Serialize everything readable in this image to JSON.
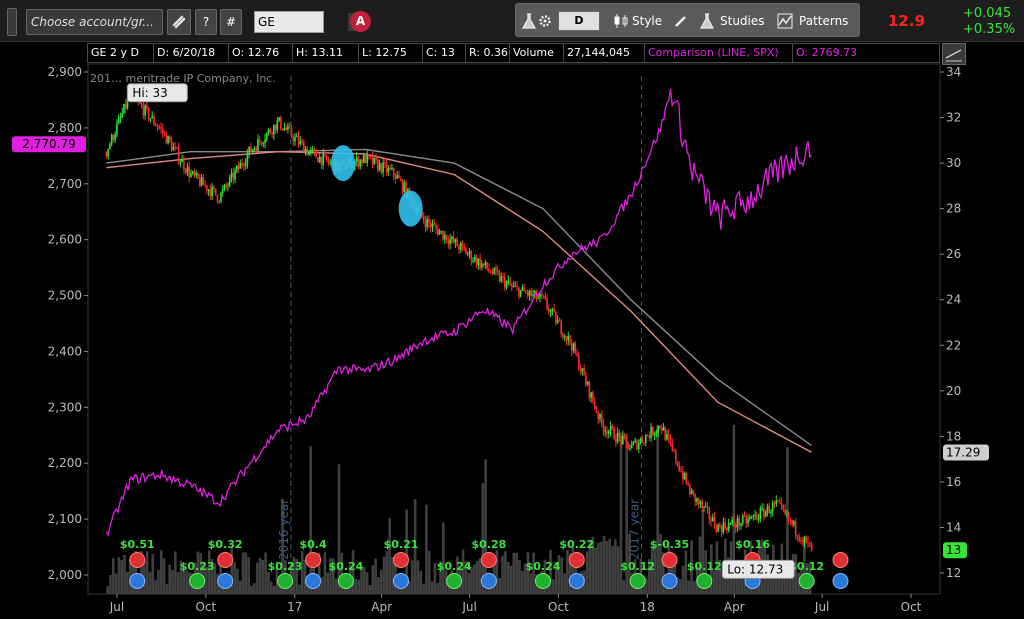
{
  "toolbar": {
    "account": "Choose account/gr...",
    "help": "?",
    "hash": "#",
    "symbol": "GE",
    "x": "✕",
    "acct_badge": "A",
    "aggregation": "D",
    "style": "Style",
    "studies": "Studies",
    "patterns": "Patterns",
    "last": "12.9",
    "change": "+0.045",
    "change_pct": "+0.35%"
  },
  "infobar": {
    "label": "GE 2 y D",
    "date": "D: 6/20/18",
    "open": "O: 12.76",
    "high": "H: 13.11",
    "low": "L: 12.75",
    "close": "C: 13",
    "range": "R: 0.36",
    "volume_label": "Volume",
    "volume": "27,144,045",
    "comparison": "Comparison (LINE, SPX)",
    "comparison_open": "O: 2769.73"
  },
  "colors": {
    "up": "#2ee62e",
    "down": "#ff2a2a",
    "comparison": "#e020e0",
    "ma_fast": "#e08a80",
    "ma_slow": "#8c8c8c",
    "volume": "#555555",
    "bg": "#000000",
    "grid": "#3a3a3a",
    "highlight": "#30c0f0"
  },
  "chart_data": {
    "type": "candlestick",
    "title": "",
    "copyright": "201… meritrade IP Company, Inc.",
    "x_ticks": [
      "Jul",
      "Oct",
      "17",
      "Apr",
      "Jul",
      "Oct",
      "18",
      "Apr",
      "Jul",
      "Oct"
    ],
    "period_labels": [
      "2016 year",
      "2017 year"
    ],
    "yright": {
      "min": 12,
      "max": 34,
      "ticks": [
        "12",
        "14",
        "16",
        "18",
        "20",
        "22",
        "24",
        "26",
        "28",
        "30",
        "32",
        "34"
      ]
    },
    "yleft": {
      "min": 2000,
      "max": 2900,
      "ticks": [
        "2,000",
        "2,100",
        "2,200",
        "2,300",
        "2,400",
        "2,500",
        "2,600",
        "2,700",
        "2,800",
        "2,900"
      ]
    },
    "price_series": {
      "name": "GE",
      "x": [
        "2016-06-20",
        "2016-07-15",
        "2016-08-15",
        "2016-09-15",
        "2016-10-15",
        "2016-11-15",
        "2016-12-15",
        "2017-01-15",
        "2017-02-15",
        "2017-03-15",
        "2017-04-15",
        "2017-05-15",
        "2017-06-15",
        "2017-07-15",
        "2017-08-15",
        "2017-09-15",
        "2017-10-15",
        "2017-11-15",
        "2017-12-15",
        "2018-01-15",
        "2018-02-15",
        "2018-03-15",
        "2018-04-15",
        "2018-05-15",
        "2018-06-20"
      ],
      "y": [
        30.5,
        33,
        31.5,
        29.5,
        28.5,
        30.5,
        31.8,
        30.5,
        29.8,
        30.2,
        29.5,
        27.5,
        26.5,
        25.5,
        24.5,
        24,
        22,
        18.5,
        17.5,
        18.5,
        15.5,
        14,
        14.3,
        15,
        13
      ]
    },
    "comparison_series": {
      "name": "SPX",
      "x": [
        "2016-06-20",
        "2016-07-15",
        "2016-08-15",
        "2016-09-15",
        "2016-10-15",
        "2016-11-15",
        "2016-12-15",
        "2017-01-15",
        "2017-02-15",
        "2017-03-15",
        "2017-04-15",
        "2017-05-15",
        "2017-06-15",
        "2017-07-15",
        "2017-08-15",
        "2017-09-15",
        "2017-10-15",
        "2017-11-15",
        "2017-12-15",
        "2018-01-15",
        "2018-01-26",
        "2018-02-15",
        "2018-03-15",
        "2018-04-15",
        "2018-05-15",
        "2018-06-20"
      ],
      "y": [
        2071,
        2170,
        2180,
        2160,
        2130,
        2198,
        2260,
        2280,
        2370,
        2365,
        2385,
        2420,
        2435,
        2475,
        2440,
        2520,
        2575,
        2600,
        2680,
        2800,
        2872,
        2730,
        2640,
        2670,
        2720,
        2770
      ]
    },
    "ma_fast": {
      "x": [
        "2016-06-20",
        "2016-09-15",
        "2016-12-15",
        "2017-03-15",
        "2017-06-15",
        "2017-09-15",
        "2017-12-15",
        "2018-03-15",
        "2018-06-20"
      ],
      "y": [
        29.8,
        30.2,
        30.5,
        30.4,
        29.5,
        27,
        23.5,
        19.5,
        17.3
      ]
    },
    "ma_slow": {
      "x": [
        "2016-06-20",
        "2016-09-15",
        "2016-12-15",
        "2017-03-15",
        "2017-06-15",
        "2017-09-15",
        "2017-12-15",
        "2018-03-15",
        "2018-06-20"
      ],
      "y": [
        30,
        30.5,
        30.5,
        30.6,
        30,
        28,
        24,
        20.5,
        17.6
      ]
    },
    "volume_area": true,
    "annotations": [
      {
        "text": "Hi: 33",
        "date": "2016-07-20",
        "value": 33
      },
      {
        "text": "Lo: 12.73",
        "date": "2018-04-01",
        "value": 12.73
      }
    ],
    "markers": [
      {
        "type": "dividend",
        "text": "$0.23",
        "date": "2016-09-22",
        "row": "lower"
      },
      {
        "type": "dividend",
        "text": "$0.23",
        "date": "2016-12-22",
        "row": "lower"
      },
      {
        "type": "dividend",
        "text": "$0.24",
        "date": "2017-02-23",
        "row": "lower"
      },
      {
        "type": "dividend",
        "text": "$0.24",
        "date": "2017-06-15",
        "row": "lower"
      },
      {
        "type": "dividend",
        "text": "$0.24",
        "date": "2017-09-15",
        "row": "lower"
      },
      {
        "type": "dividend",
        "text": "$0.12",
        "date": "2017-12-22",
        "row": "lower"
      },
      {
        "type": "dividend",
        "text": "$0.12",
        "date": "2018-03-01",
        "row": "lower"
      },
      {
        "type": "dividend",
        "text": "$0.12",
        "date": "2018-06-15",
        "row": "lower"
      },
      {
        "type": "earnings",
        "text": "$0.51",
        "date": "2016-07-22",
        "row": "upper"
      },
      {
        "type": "earnings",
        "text": "$0.32",
        "date": "2016-10-21",
        "row": "upper"
      },
      {
        "type": "earnings",
        "text": "$0.4",
        "date": "2017-01-20",
        "row": "upper"
      },
      {
        "type": "earnings",
        "text": "$0.21",
        "date": "2017-04-21",
        "row": "upper"
      },
      {
        "type": "earnings",
        "text": "$0.28",
        "date": "2017-07-21",
        "row": "upper"
      },
      {
        "type": "earnings",
        "text": "$0.22",
        "date": "2017-10-20",
        "row": "upper"
      },
      {
        "type": "earnings",
        "text": "$-0.35",
        "date": "2018-01-24",
        "row": "upper"
      },
      {
        "type": "earnings",
        "text": "$0.16",
        "date": "2018-04-20",
        "row": "upper"
      }
    ],
    "event_icon_dates": [
      "2016-07-22",
      "2016-10-21",
      "2017-01-20",
      "2017-04-21",
      "2017-07-21",
      "2017-10-20",
      "2018-01-24",
      "2018-04-20",
      "2018-07-20"
    ],
    "highlights": [
      {
        "date": "2017-02-20",
        "value": 30
      },
      {
        "date": "2017-05-01",
        "value": 28
      }
    ],
    "price_bubbles": [
      {
        "text": "2,770.79",
        "axis": "left",
        "value": 2770.79
      },
      {
        "text": "17.29",
        "axis": "right",
        "value": 17.29
      },
      {
        "text": "13",
        "axis": "right",
        "value": 13
      }
    ],
    "grid": "vertical-dotted",
    "legend": "none"
  }
}
